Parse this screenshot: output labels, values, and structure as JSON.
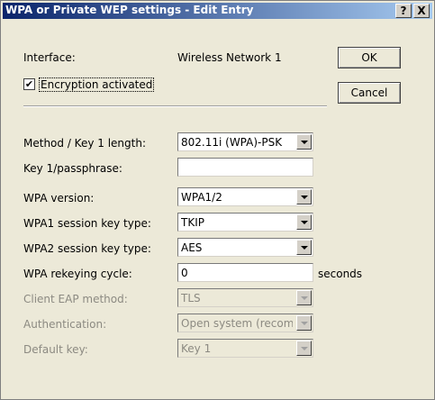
{
  "window": {
    "title": "WPA or Private WEP settings - Edit Entry",
    "help_glyph": "?",
    "close_glyph": "X"
  },
  "interface": {
    "label": "Interface:",
    "value": "Wireless Network 1"
  },
  "encryption": {
    "label": "Encryption activated",
    "checked": true,
    "check_glyph": "✔"
  },
  "buttons": {
    "ok": "OK",
    "cancel": "Cancel"
  },
  "fields": {
    "method": {
      "label": "Method / Key 1 length:",
      "value": "802.11i (WPA)-PSK"
    },
    "key": {
      "label": "Key 1/passphrase:",
      "value": ""
    },
    "wpa_version": {
      "label": "WPA version:",
      "value": "WPA1/2"
    },
    "wpa1_session": {
      "label": "WPA1 session key type:",
      "value": "TKIP"
    },
    "wpa2_session": {
      "label": "WPA2 session key type:",
      "value": "AES"
    },
    "rekey": {
      "label": "WPA rekeying cycle:",
      "value": "0",
      "unit": "seconds"
    },
    "eap": {
      "label": "Client EAP method:",
      "value": "TLS",
      "disabled": true
    },
    "auth": {
      "label": "Authentication:",
      "value": "Open system (recom",
      "disabled": true
    },
    "default_key": {
      "label": "Default key:",
      "value": "Key 1",
      "disabled": true
    }
  }
}
